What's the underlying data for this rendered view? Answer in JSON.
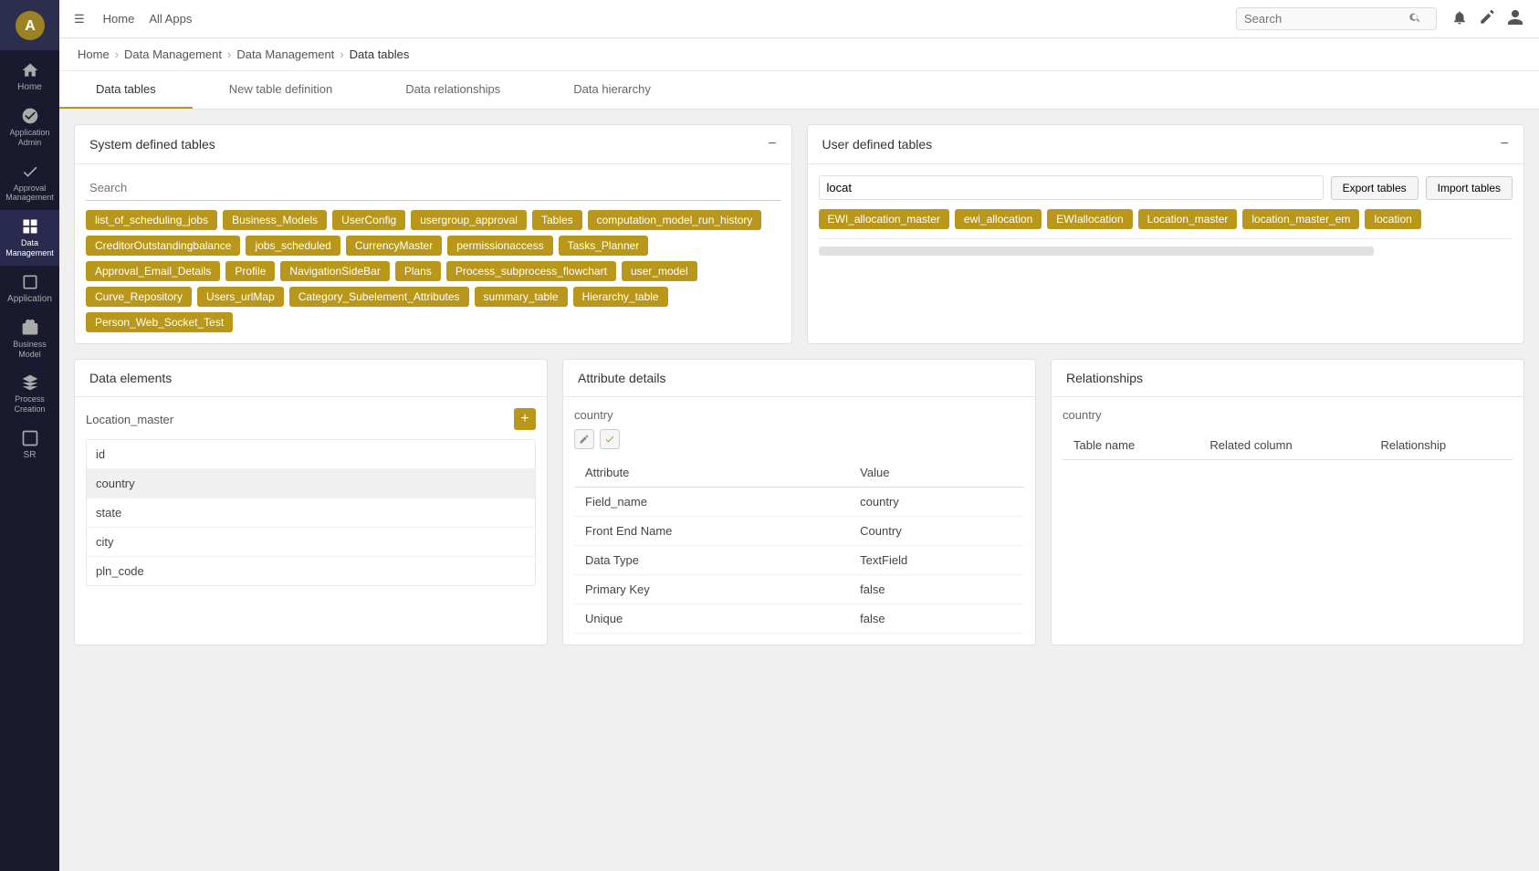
{
  "app": {
    "logo_text": "A",
    "menu_icon": "☰"
  },
  "topbar": {
    "menu_icon": "☰",
    "nav_home": "Home",
    "nav_apps": "All Apps",
    "search_placeholder": "Search"
  },
  "breadcrumb": {
    "home": "Home",
    "sep1": ">",
    "level1": "Data Management",
    "sep2": ">",
    "level2": "Data Management",
    "sep3": ">",
    "current": "Data tables"
  },
  "tabs": [
    {
      "id": "data-tables",
      "label": "Data tables",
      "active": true
    },
    {
      "id": "new-table",
      "label": "New table definition",
      "active": false
    },
    {
      "id": "data-relationships",
      "label": "Data relationships",
      "active": false
    },
    {
      "id": "data-hierarchy",
      "label": "Data hierarchy",
      "active": false
    }
  ],
  "sidebar": {
    "items": [
      {
        "id": "home",
        "label": "Home",
        "icon": "⌂"
      },
      {
        "id": "app-admin",
        "label": "Application Admin",
        "icon": "⚙"
      },
      {
        "id": "approval",
        "label": "Approval Management",
        "icon": "✓"
      },
      {
        "id": "data-mgmt",
        "label": "Data Management",
        "icon": "▦",
        "active": true
      },
      {
        "id": "application",
        "label": "Application",
        "icon": "◫"
      },
      {
        "id": "business",
        "label": "Business Model",
        "icon": "◈"
      },
      {
        "id": "process",
        "label": "Process Creation",
        "icon": "⬡"
      },
      {
        "id": "sr",
        "label": "SR",
        "icon": "◻"
      }
    ]
  },
  "system_tables": {
    "title": "System defined tables",
    "search_placeholder": "Search",
    "tags": [
      "list_of_scheduling_jobs",
      "Business_Models",
      "UserConfig",
      "usergroup_approval",
      "Tables",
      "computation_model_run_history",
      "CreditorOutstandingbalance",
      "jobs_scheduled",
      "CurrencyMaster",
      "permissionaccess",
      "Tasks_Planner",
      "Approval_Email_Details",
      "Profile",
      "NavigationSideBar",
      "Plans",
      "Process_subprocess_flowchart",
      "user_model",
      "Curve_Repository",
      "Users_urlMap",
      "Category_Subelement_Attributes",
      "summary_table",
      "Hierarchy_table",
      "Person_Web_Socket_Test"
    ]
  },
  "user_tables": {
    "title": "User defined tables",
    "search_value": "locat",
    "export_label": "Export tables",
    "import_label": "Import tables",
    "tags": [
      "EWI_allocation_master",
      "ewi_allocation",
      "EWIallocation",
      "Location_master",
      "location_master_em",
      "location"
    ]
  },
  "data_elements": {
    "title": "Data elements",
    "selected_table": "Location_master",
    "items": [
      {
        "id": "id",
        "label": "id"
      },
      {
        "id": "country",
        "label": "country",
        "selected": true
      },
      {
        "id": "state",
        "label": "state"
      },
      {
        "id": "city",
        "label": "city"
      },
      {
        "id": "pln_code",
        "label": "pln_code"
      }
    ]
  },
  "attribute_details": {
    "title": "Attribute details",
    "selected_field": "country",
    "columns": [
      "Attribute",
      "Value"
    ],
    "rows": [
      {
        "attribute": "Field_name",
        "value": "country"
      },
      {
        "attribute": "Front End Name",
        "value": "Country"
      },
      {
        "attribute": "Data Type",
        "value": "TextField"
      },
      {
        "attribute": "Primary Key",
        "value": "false"
      },
      {
        "attribute": "Unique",
        "value": "false"
      }
    ]
  },
  "relationships": {
    "title": "Relationships",
    "selected_field": "country",
    "columns": [
      "Table name",
      "Related column",
      "Relationship"
    ],
    "rows": []
  }
}
